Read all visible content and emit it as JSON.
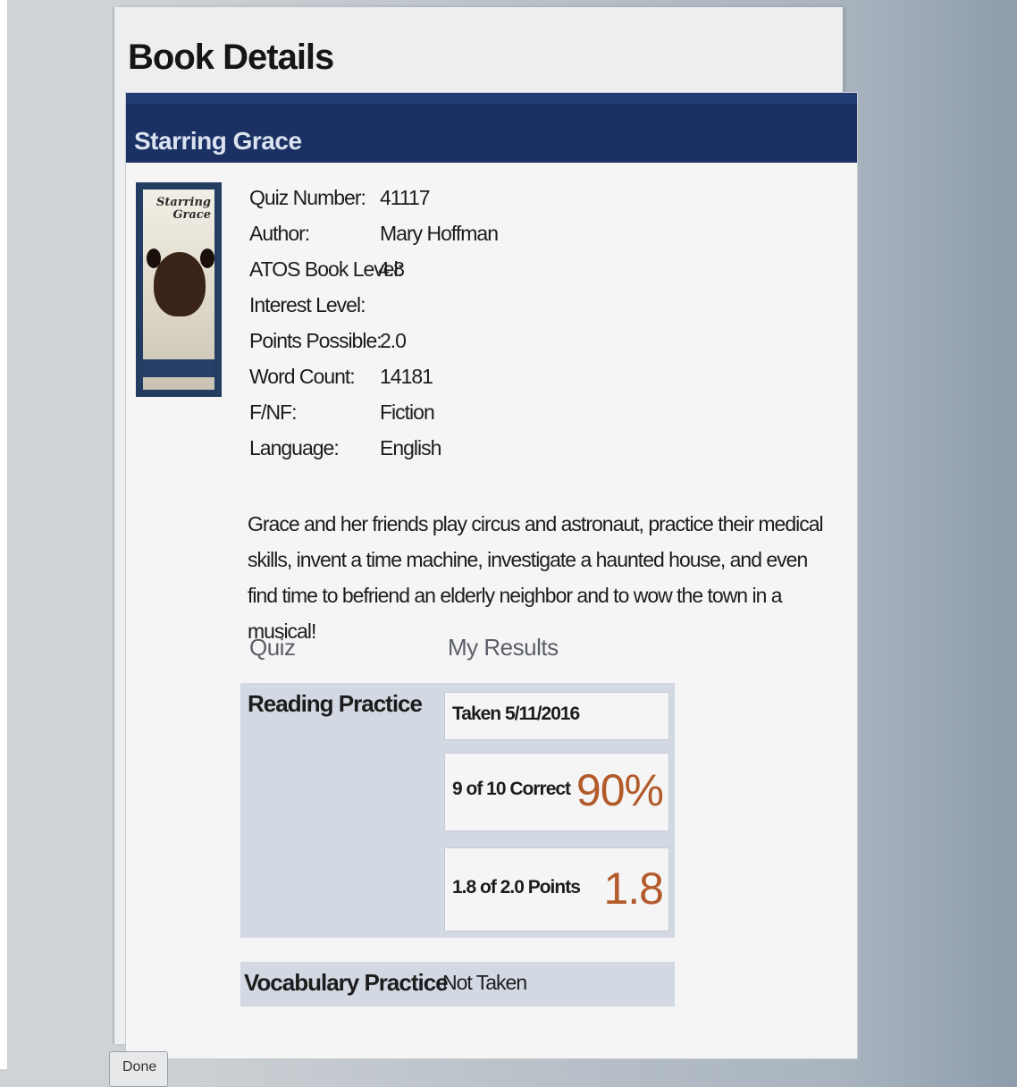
{
  "page": {
    "title": "Book Details"
  },
  "book": {
    "title": "Starring Grace",
    "cover": {
      "title_line1": "Starring",
      "title_line2": "Grace"
    },
    "details": [
      {
        "label": "Quiz Number:",
        "value": "41117"
      },
      {
        "label": "Author:",
        "value": "Mary Hoffman"
      },
      {
        "label": "ATOS Book Level:",
        "value": "4.8"
      },
      {
        "label": "Interest Level:",
        "value": ""
      },
      {
        "label": "Points Possible:",
        "value": "2.0"
      },
      {
        "label": "Word Count:",
        "value": "14181"
      },
      {
        "label": "F/NF:",
        "value": "Fiction"
      },
      {
        "label": "Language:",
        "value": "English"
      }
    ],
    "description": "Grace and her friends play circus and astronaut, practice their medical skills, invent a time machine, investigate a haunted house, and even find time to befriend an elderly neighbor and to wow the town in a musical!"
  },
  "results": {
    "quiz_header": "Quiz",
    "my_results_header": "My Results",
    "reading_practice": {
      "label": "Reading Practice",
      "taken": "Taken 5/11/2016",
      "correct": "9 of 10 Correct",
      "percent": "90%",
      "points": "1.8 of 2.0 Points",
      "points_value": "1.8"
    },
    "vocabulary_practice": {
      "label": "Vocabulary Practice",
      "status": "Not Taken"
    }
  },
  "footer": {
    "button_label": "Done"
  },
  "colors": {
    "header_bg": "#1b3163",
    "accent_orange": "#b35a2a",
    "results_bg": "#d2d9e3"
  }
}
